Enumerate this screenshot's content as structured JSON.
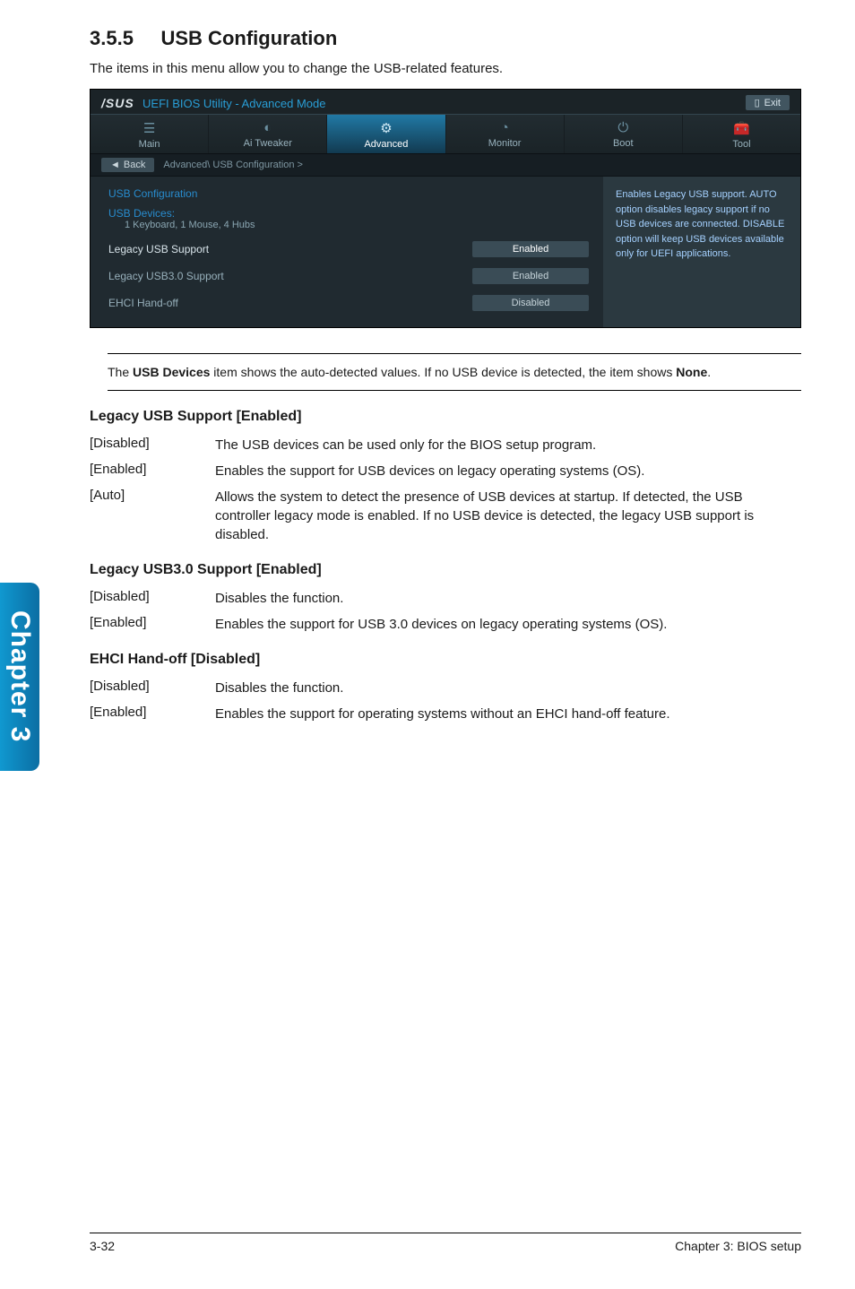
{
  "side_tab": "Chapter 3",
  "section": {
    "number": "3.5.5",
    "title": "USB Configuration",
    "intro": "The items in this menu allow you to change the USB-related features."
  },
  "bios": {
    "brand": "/SUS",
    "utility_title": "UEFI BIOS Utility - Advanced Mode",
    "exit": "Exit",
    "tabs": {
      "main": "Main",
      "ai_tweaker": "Ai Tweaker",
      "advanced": "Advanced",
      "monitor": "Monitor",
      "boot": "Boot",
      "tool": "Tool"
    },
    "back": "Back",
    "breadcrumb": "Advanced\\ USB Configuration  >",
    "group_title": "USB Configuration",
    "usb_devices_label": "USB Devices:",
    "usb_devices_value": "1 Keyboard, 1 Mouse, 4 Hubs",
    "rows": {
      "legacy_usb_support": {
        "label": "Legacy USB Support",
        "value": "Enabled"
      },
      "legacy_usb30_support": {
        "label": "Legacy USB3.0 Support",
        "value": "Enabled"
      },
      "ehci_hand_off": {
        "label": "EHCI Hand-off",
        "value": "Disabled"
      }
    },
    "help_text": "Enables Legacy USB support. AUTO option disables legacy support if no USB devices are connected. DISABLE option will keep USB devices available only for UEFI applications."
  },
  "note": {
    "pre": "The ",
    "bold1": "USB Devices",
    "mid": " item shows the auto-detected values. If no USB device is detected, the item shows ",
    "bold2": "None",
    "post": "."
  },
  "sections": {
    "legacy_usb": {
      "heading": "Legacy USB Support [Enabled]",
      "disabled": {
        "key": "[Disabled]",
        "desc": "The USB devices can be used only for the BIOS setup program."
      },
      "enabled": {
        "key": "[Enabled]",
        "desc": "Enables the support for USB devices on legacy operating systems (OS)."
      },
      "auto": {
        "key": "[Auto]",
        "desc": "Allows the system to detect the presence of USB devices at startup. If detected, the USB controller legacy mode is enabled. If no USB device is detected, the legacy USB support is disabled."
      }
    },
    "legacy_usb30": {
      "heading": "Legacy USB3.0 Support [Enabled]",
      "disabled": {
        "key": "[Disabled]",
        "desc": "Disables the function."
      },
      "enabled": {
        "key": "[Enabled]",
        "desc": "Enables the support for USB 3.0 devices on legacy operating systems (OS)."
      }
    },
    "ehci": {
      "heading": "EHCI Hand-off [Disabled]",
      "disabled": {
        "key": "[Disabled]",
        "desc": "Disables the function."
      },
      "enabled": {
        "key": "[Enabled]",
        "desc": "Enables the support for operating systems without an EHCI hand-off feature."
      }
    }
  },
  "footer": {
    "left": "3-32",
    "right": "Chapter 3: BIOS setup"
  }
}
